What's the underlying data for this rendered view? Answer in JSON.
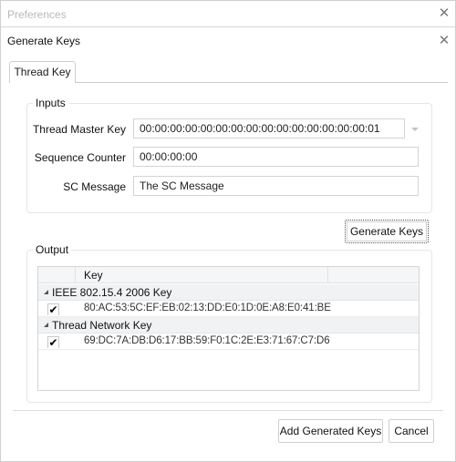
{
  "outer_window": {
    "title": "Preferences",
    "close_icon": "close-icon"
  },
  "dialog": {
    "title": "Generate Keys",
    "close_icon": "close-icon"
  },
  "tabs": [
    {
      "label": "Thread Key",
      "active": true
    }
  ],
  "inputs": {
    "legend": "Inputs",
    "thread_master_key": {
      "label": "Thread Master Key",
      "value": "00:00:00:00:00:00:00:00:00:00:00:00:00:00:00:01",
      "dropdown_icon": "chevron-down-icon"
    },
    "sequence_counter": {
      "label": "Sequence Counter",
      "value": "00:00:00:00"
    },
    "sc_message": {
      "label": "SC Message",
      "value": "The SC Message"
    }
  },
  "generate_button": {
    "label": "Generate Keys"
  },
  "output": {
    "legend": "Output",
    "columns": [
      "",
      "Key",
      ""
    ],
    "groups": [
      {
        "label": "IEEE 802.15.4 2006 Key",
        "expanded": true,
        "rows": [
          {
            "checked": true,
            "check_glyph": "✔",
            "key": "80:AC:53:5C:EF:EB:02:13:DD:E0:1D:0E:A8:E0:41:BE"
          }
        ]
      },
      {
        "label": "Thread Network Key",
        "expanded": true,
        "rows": [
          {
            "checked": true,
            "check_glyph": "✔",
            "key": "69:DC:7A:DB:D6:17:BB:59:F0:1C:2E:E3:71:67:C7:D6"
          }
        ]
      }
    ]
  },
  "footer": {
    "add_label": "Add Generated Keys",
    "cancel_label": "Cancel"
  },
  "icons": {
    "close": "✕"
  }
}
